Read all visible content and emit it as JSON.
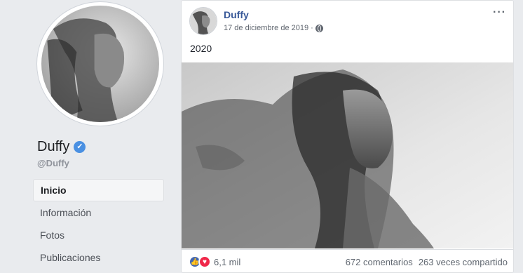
{
  "page": {
    "name": "Duffy",
    "handle": "@Duffy"
  },
  "nav": {
    "items": [
      {
        "label": "Inicio"
      },
      {
        "label": "Información"
      },
      {
        "label": "Fotos"
      },
      {
        "label": "Publicaciones"
      }
    ]
  },
  "post": {
    "author": "Duffy",
    "date": "17 de diciembre de 2019 ·",
    "text": "2020",
    "reactions_count": "6,1 mil",
    "comments": "672 comentarios",
    "shares": "263 veces compartido"
  },
  "icons": {
    "verified": "verified-check-icon",
    "globe": "globe-icon",
    "more": "more-options-icon",
    "like": "like-reaction-icon",
    "love": "love-reaction-icon"
  },
  "colors": {
    "accent": "#385898",
    "verified": "#4a90e2",
    "like": "#4267b2",
    "love": "#f0284a"
  }
}
